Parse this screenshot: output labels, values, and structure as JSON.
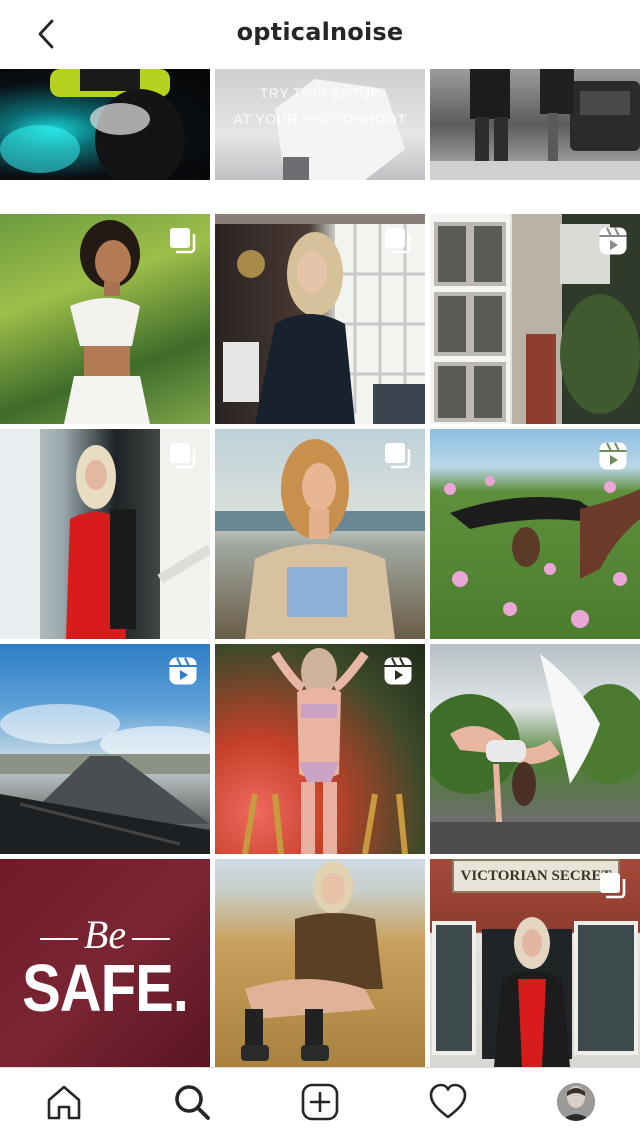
{
  "header": {
    "title": "opticalnoise",
    "back_icon": "chevron-left-icon"
  },
  "grid": {
    "tiles": [
      {
        "name": "tile-smoke-helmet",
        "badge": "none"
      },
      {
        "name": "tile-try-setup",
        "badge": "none",
        "text_line1": "TRY THIS SETUP",
        "text_line2": "AT YOUR PHOTOSHOOT"
      },
      {
        "name": "tile-couple-truck",
        "badge": "none"
      },
      {
        "name": "tile-woman-white-top",
        "badge": "carousel"
      },
      {
        "name": "tile-woman-doorway",
        "badge": "carousel"
      },
      {
        "name": "tile-window-frame",
        "badge": "reel"
      },
      {
        "name": "tile-woman-red-dress-mirror",
        "badge": "carousel"
      },
      {
        "name": "tile-woman-fur-coat",
        "badge": "carousel"
      },
      {
        "name": "tile-backbend-flowers",
        "badge": "reel"
      },
      {
        "name": "tile-road-windshield",
        "badge": "reel"
      },
      {
        "name": "tile-woman-bikini",
        "badge": "reel"
      },
      {
        "name": "tile-dancer-leap",
        "badge": "none"
      },
      {
        "name": "tile-be-safe",
        "badge": "none",
        "text_be": "Be",
        "text_safe": "SAFE."
      },
      {
        "name": "tile-woman-sitting-sand",
        "badge": "none"
      },
      {
        "name": "tile-victorian-secret",
        "badge": "carousel",
        "sign_text": "VICTORIAN SECRET"
      }
    ]
  },
  "tabbar": {
    "items": [
      {
        "name": "home",
        "icon": "home-icon"
      },
      {
        "name": "search",
        "icon": "search-icon",
        "active": true
      },
      {
        "name": "create",
        "icon": "add-post-icon"
      },
      {
        "name": "activity",
        "icon": "heart-icon"
      },
      {
        "name": "profile",
        "icon": "avatar"
      }
    ]
  },
  "colors": {
    "text": "#262626",
    "divider": "#dbdbdb",
    "background": "#ffffff"
  }
}
